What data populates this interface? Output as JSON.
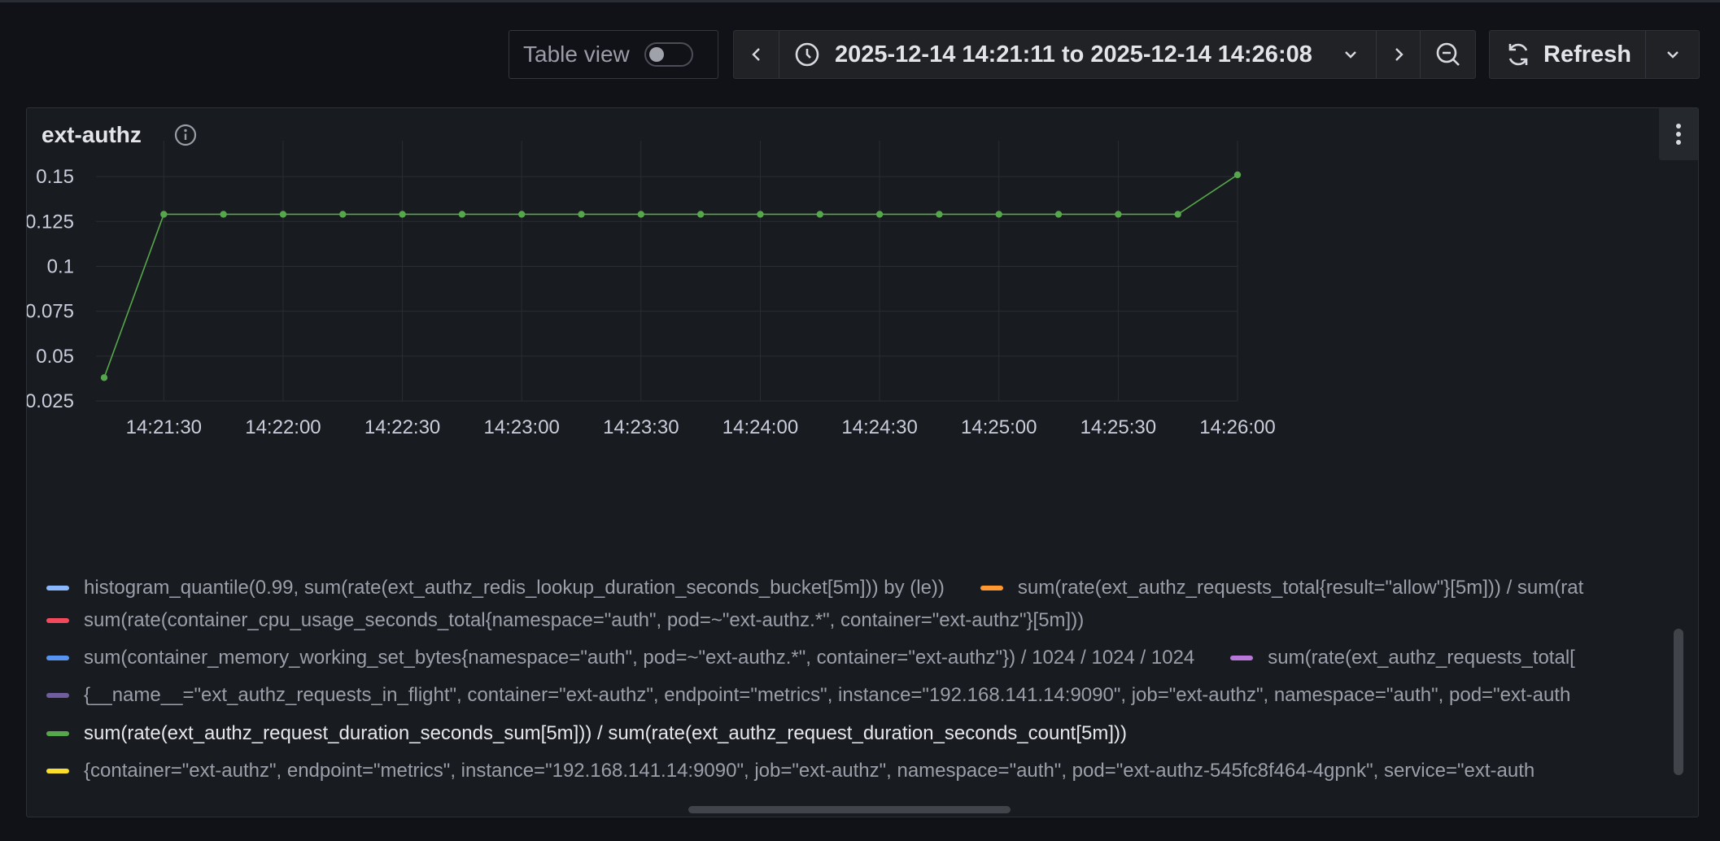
{
  "toolbar": {
    "table_view_label": "Table view",
    "table_view_on": false,
    "time_range": "2025-12-14 14:21:11 to 2025-12-14 14:26:08",
    "refresh_label": "Refresh"
  },
  "panel": {
    "title": "ext-authz"
  },
  "colors": {
    "series_active": "#56a64b",
    "legend": [
      "#8ab8ff",
      "#ff9830",
      "#f2495c",
      "#5794f2",
      "#b877d9",
      "#705da0",
      "#56a64b",
      "#fade2a"
    ]
  },
  "chart_data": {
    "type": "line",
    "x": [
      "14:21:15",
      "14:21:30",
      "14:21:45",
      "14:22:00",
      "14:22:15",
      "14:22:30",
      "14:22:45",
      "14:23:00",
      "14:23:15",
      "14:23:30",
      "14:23:45",
      "14:24:00",
      "14:24:15",
      "14:24:30",
      "14:24:45",
      "14:25:00",
      "14:25:15",
      "14:25:30",
      "14:25:45",
      "14:26:00"
    ],
    "series": [
      {
        "name": "sum(rate(ext_authz_request_duration_seconds_sum[5m])) / sum(rate(ext_authz_request_duration_seconds_count[5m]))",
        "values": [
          0.038,
          0.129,
          0.129,
          0.129,
          0.129,
          0.129,
          0.129,
          0.129,
          0.129,
          0.129,
          0.129,
          0.129,
          0.129,
          0.129,
          0.129,
          0.129,
          0.129,
          0.129,
          0.129,
          0.151
        ]
      }
    ],
    "x_ticks": [
      "14:21:30",
      "14:22:00",
      "14:22:30",
      "14:23:00",
      "14:23:30",
      "14:24:00",
      "14:24:30",
      "14:25:00",
      "14:25:30",
      "14:26:00"
    ],
    "y_ticks": [
      "0.025",
      "0.05",
      "0.075",
      "0.1",
      "0.125",
      "0.15"
    ],
    "ylim": [
      0.025,
      0.17
    ],
    "grid": true,
    "legend_position": "bottom"
  },
  "legend": {
    "rows": [
      [
        "histogram_quantile(0.99, sum(rate(ext_authz_redis_lookup_duration_seconds_bucket[5m])) by (le))",
        "sum(rate(ext_authz_requests_total{result=\"allow\"}[5m])) / sum(rat"
      ],
      [
        "sum(rate(container_cpu_usage_seconds_total{namespace=\"auth\", pod=~\"ext-authz.*\", container=\"ext-authz\"}[5m]))"
      ],
      [
        "sum(container_memory_working_set_bytes{namespace=\"auth\", pod=~\"ext-authz.*\", container=\"ext-authz\"}) / 1024 / 1024 / 1024",
        "sum(rate(ext_authz_requests_total["
      ],
      [
        "{__name__=\"ext_authz_requests_in_flight\", container=\"ext-authz\", endpoint=\"metrics\", instance=\"192.168.141.14:9090\", job=\"ext-authz\", namespace=\"auth\", pod=\"ext-auth"
      ],
      [
        "sum(rate(ext_authz_request_duration_seconds_sum[5m])) / sum(rate(ext_authz_request_duration_seconds_count[5m]))"
      ],
      [
        "{container=\"ext-authz\", endpoint=\"metrics\", instance=\"192.168.141.14:9090\", job=\"ext-authz\", namespace=\"auth\", pod=\"ext-authz-545fc8f464-4gpnk\", service=\"ext-auth"
      ]
    ]
  }
}
